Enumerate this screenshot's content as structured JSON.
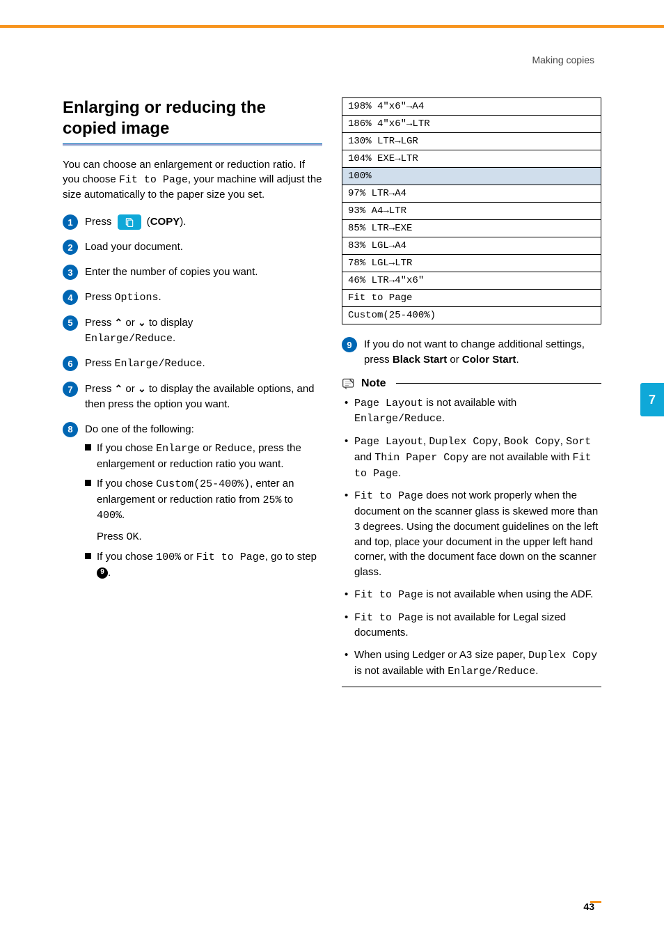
{
  "header": {
    "section": "Making copies"
  },
  "title": "Enlarging or reducing the copied image",
  "intro_a": "You can choose an enlargement or reduction ratio. If you choose ",
  "intro_code": "Fit to Page",
  "intro_b": ", your machine will adjust the size automatically to the paper size you set.",
  "steps": {
    "s1_a": "Press ",
    "s1_b": " (",
    "s1_c": "COPY",
    "s1_d": ").",
    "s2": "Load your document.",
    "s3": "Enter the number of copies you want.",
    "s4_a": "Press ",
    "s4_b": "Options",
    "s4_c": ".",
    "s5_a": "Press ",
    "s5_b": " or ",
    "s5_c": " to display ",
    "s5_d": "Enlarge/Reduce",
    "s5_e": ".",
    "s6_a": "Press ",
    "s6_b": "Enlarge/Reduce",
    "s6_c": ".",
    "s7_a": "Press ",
    "s7_b": " or ",
    "s7_c": " to display the available options, and then press the option you want.",
    "s8": "Do one of the following:",
    "s8b1_a": "If you chose ",
    "s8b1_b": "Enlarge",
    "s8b1_c": " or ",
    "s8b1_d": "Reduce",
    "s8b1_e": ", press the enlargement or reduction ratio you want.",
    "s8b2_a": "If you chose ",
    "s8b2_b": "Custom(25-400%)",
    "s8b2_c": ", enter an enlargement or reduction ratio from ",
    "s8b2_d": "25%",
    "s8b2_e": " to ",
    "s8b2_f": "400%",
    "s8b2_g": ".",
    "s8b2_h": "Press ",
    "s8b2_i": "OK",
    "s8b2_j": ".",
    "s8b3_a": "If you chose ",
    "s8b3_b": "100%",
    "s8b3_c": " or ",
    "s8b3_d": "Fit to Page",
    "s8b3_e": ", go to step ",
    "s8b3_f": "9",
    "s8b3_g": ".",
    "s9_a": "If you do not want to change additional settings, press ",
    "s9_b": "Black Start",
    "s9_c": " or ",
    "s9_d": "Color Start",
    "s9_e": "."
  },
  "ratios": [
    {
      "t": "198% 4\"x6\"→A4",
      "hl": false
    },
    {
      "t": "186% 4\"x6\"→LTR",
      "hl": false
    },
    {
      "t": "130% LTR→LGR",
      "hl": false
    },
    {
      "t": "104% EXE→LTR",
      "hl": false
    },
    {
      "t": "100%",
      "hl": true
    },
    {
      "t": "97% LTR→A4",
      "hl": false
    },
    {
      "t": "93% A4→LTR",
      "hl": false
    },
    {
      "t": "85% LTR→EXE",
      "hl": false
    },
    {
      "t": "83% LGL→A4",
      "hl": false
    },
    {
      "t": "78% LGL→LTR",
      "hl": false
    },
    {
      "t": "46% LTR→4\"x6\"",
      "hl": false
    },
    {
      "t": "Fit to Page",
      "hl": false
    },
    {
      "t": "Custom(25-400%)",
      "hl": false
    }
  ],
  "note_label": "Note",
  "notes": {
    "n1_a": "Page Layout",
    "n1_b": " is not available with ",
    "n1_c": "Enlarge/Reduce",
    "n1_d": ".",
    "n2_a": "Page Layout",
    "n2_b": ", ",
    "n2_c": "Duplex Copy",
    "n2_d": ", ",
    "n2_e": "Book Copy",
    "n2_f": ", ",
    "n2_g": "Sort",
    "n2_h": " and ",
    "n2_i": "Thin Paper Copy",
    "n2_j": " are not available with ",
    "n2_k": "Fit to Page",
    "n2_l": ".",
    "n3_a": "Fit to Page",
    "n3_b": " does not work properly when the document on the scanner glass is skewed more than 3 degrees. Using the document guidelines on the left and top, place your document in the upper left hand corner, with the document face down on the scanner glass.",
    "n4_a": "Fit to Page",
    "n4_b": " is not available when using the ADF.",
    "n5_a": "Fit to Page",
    "n5_b": " is not available for Legal sized documents.",
    "n6_a": "When using Ledger or A3 size paper, ",
    "n6_b": "Duplex Copy",
    "n6_c": " is not available with ",
    "n6_d": "Enlarge/Reduce",
    "n6_e": "."
  },
  "side_tab": "7",
  "page_number": "43"
}
